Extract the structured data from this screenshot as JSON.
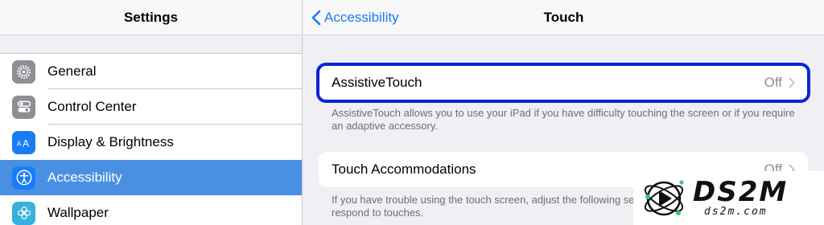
{
  "sidebar": {
    "title": "Settings",
    "items": [
      {
        "label": "General",
        "icon": "gear-icon"
      },
      {
        "label": "Control Center",
        "icon": "toggles-icon"
      },
      {
        "label": "Display & Brightness",
        "icon": "text-size-icon"
      },
      {
        "label": "Accessibility",
        "icon": "accessibility-icon",
        "selected": true
      },
      {
        "label": "Wallpaper",
        "icon": "flower-icon"
      }
    ]
  },
  "detail": {
    "back_label": "Accessibility",
    "title": "Touch",
    "assistive_touch": {
      "label": "AssistiveTouch",
      "value": "Off",
      "footer": "AssistiveTouch allows you to use your iPad if you have difficulty touching the screen or if you require an adaptive accessory."
    },
    "touch_accommodations": {
      "label": "Touch Accommodations",
      "value": "Off",
      "footer": "If you have trouble using the touch screen, adjust the following settings to change how the screen will respond to touches."
    }
  },
  "watermark": {
    "title": "DS2M",
    "subtitle": "ds2m.com"
  },
  "colors": {
    "accent": "#1a7cf5",
    "selected_row": "#4a90e2",
    "highlight_outline": "#0a24d8"
  }
}
